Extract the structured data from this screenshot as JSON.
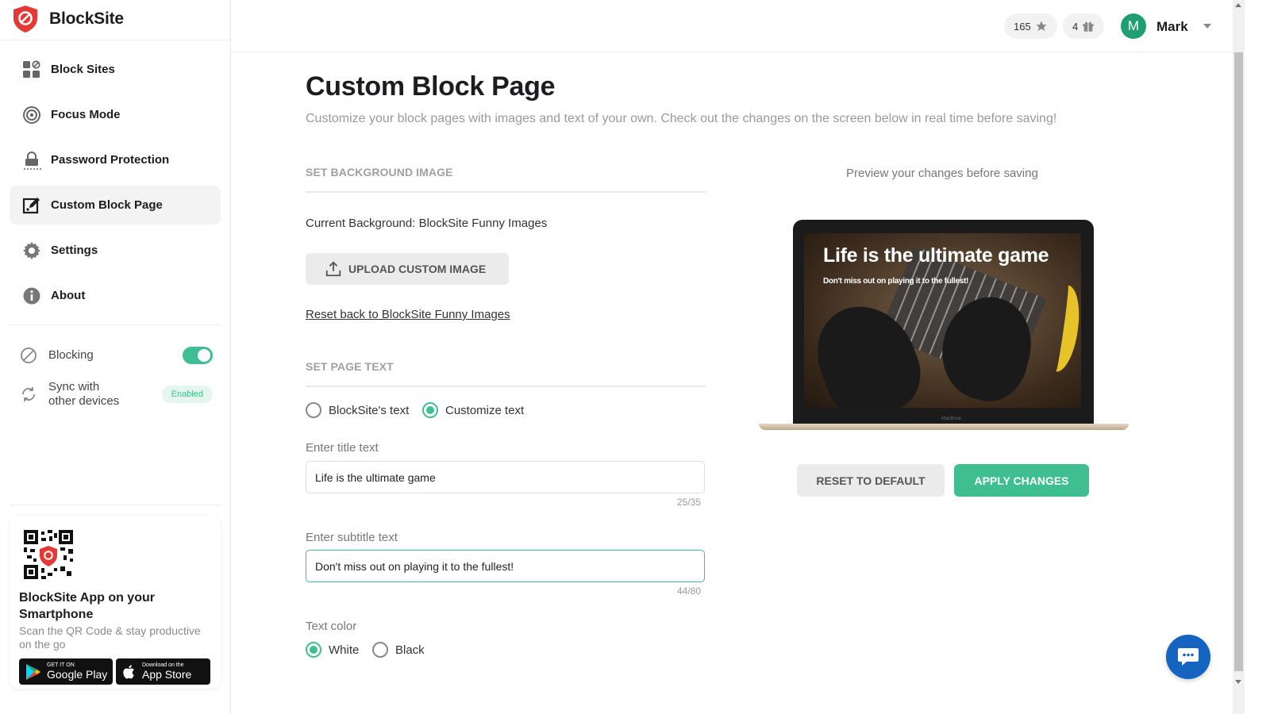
{
  "brand": {
    "name": "BlockSite"
  },
  "sidebar": {
    "nav": [
      {
        "label": "Block Sites",
        "icon": "grid-block-icon"
      },
      {
        "label": "Focus Mode",
        "icon": "target-icon"
      },
      {
        "label": "Password Protection",
        "icon": "lock-icon"
      },
      {
        "label": "Custom Block Page",
        "icon": "edit-square-icon",
        "active": true
      },
      {
        "label": "Settings",
        "icon": "gear-icon"
      },
      {
        "label": "About",
        "icon": "info-icon"
      }
    ],
    "blocking": {
      "label": "Blocking",
      "on": true
    },
    "sync": {
      "label_line1": "Sync with",
      "label_line2": "other devices",
      "badge": "Enabled"
    },
    "app_card": {
      "title": "BlockSite App on your Smartphone",
      "subtitle": "Scan the QR Code & stay productive on the go",
      "google_play_small": "GET IT ON",
      "google_play_big": "Google Play",
      "app_store_small": "Download on the",
      "app_store_big": "App Store"
    }
  },
  "header": {
    "points": "165",
    "gifts": "4",
    "avatar_initial": "M",
    "username": "Mark"
  },
  "main": {
    "title": "Custom Block Page",
    "description": "Customize your block pages with images and text of your own. Check out the changes on the screen below in real time before saving!",
    "bg_section": {
      "heading": "SET BACKGROUND IMAGE",
      "current": "Current Background: BlockSite Funny Images",
      "upload_label": "UPLOAD CUSTOM IMAGE",
      "reset_link": "Reset back to BlockSite Funny Images"
    },
    "text_section": {
      "heading": "SET PAGE TEXT",
      "option_default": "BlockSite's text",
      "option_custom": "Customize text",
      "selected": "custom",
      "title_label": "Enter title text",
      "title_value": "Life is the ultimate game",
      "title_counter": "25/35",
      "subtitle_label": "Enter subtitle text",
      "subtitle_value": "Don't miss out on playing it to the fullest!",
      "subtitle_counter": "44/80",
      "color_label": "Text color",
      "color_white": "White",
      "color_black": "Black",
      "color_selected": "white"
    },
    "preview": {
      "label": "Preview your changes before saving",
      "title": "Life is the ultimate game",
      "subtitle": "Don't miss out on playing it to the fullest!",
      "laptop_brand": "MacBook"
    },
    "buttons": {
      "reset": "RESET TO DEFAULT",
      "apply": "APPLY CHANGES"
    }
  },
  "colors": {
    "accent": "#3fbf91",
    "avatar": "#1e9e72",
    "chat": "#1565c0",
    "logo_red": "#e53935"
  }
}
